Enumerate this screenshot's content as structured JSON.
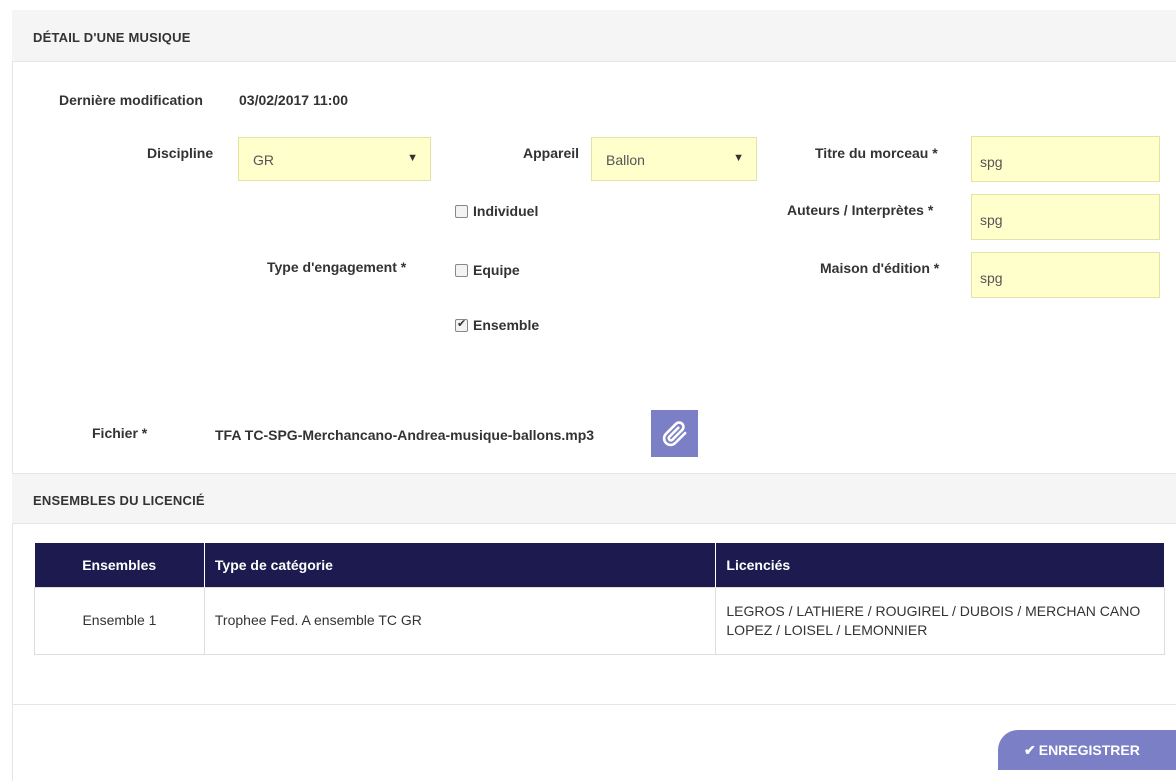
{
  "section1": {
    "title": "DÉTAIL D'UNE MUSIQUE"
  },
  "last_modified": {
    "label": "Dernière modification",
    "value": "03/02/2017 11:00"
  },
  "discipline": {
    "label": "Discipline",
    "value": "GR"
  },
  "appareil": {
    "label": "Appareil",
    "value": "Ballon"
  },
  "titre": {
    "label": "Titre du morceau *",
    "value": "spg"
  },
  "auteurs": {
    "label": "Auteurs / Interprètes *",
    "value": "spg"
  },
  "maison": {
    "label": "Maison d'édition *",
    "value": "spg"
  },
  "engagement": {
    "label": "Type d'engagement *",
    "options": [
      {
        "label": "Individuel",
        "checked": false
      },
      {
        "label": "Equipe",
        "checked": false
      },
      {
        "label": "Ensemble",
        "checked": true
      }
    ]
  },
  "fichier": {
    "label": "Fichier *",
    "value": "TFA TC-SPG-Merchancano-Andrea-musique-ballons.mp3",
    "attach_icon": "paperclip-icon"
  },
  "section2": {
    "title": "ENSEMBLES DU LICENCIÉ"
  },
  "table": {
    "headers": [
      "Ensembles",
      "Type de catégorie",
      "Licenciés"
    ],
    "rows": [
      [
        "Ensemble 1",
        "Trophee Fed. A ensemble TC GR",
        "LEGROS / LATHIERE / ROUGIREL / DUBOIS / MERCHAN CANO LOPEZ / LOISEL / LEMONNIER"
      ]
    ]
  },
  "save_button": {
    "label": "ENREGISTRER",
    "icon": "check-icon"
  },
  "colors": {
    "accent": "#7b7fc6",
    "table_header": "#1c1a4e",
    "field_bg": "#ffffcc"
  }
}
